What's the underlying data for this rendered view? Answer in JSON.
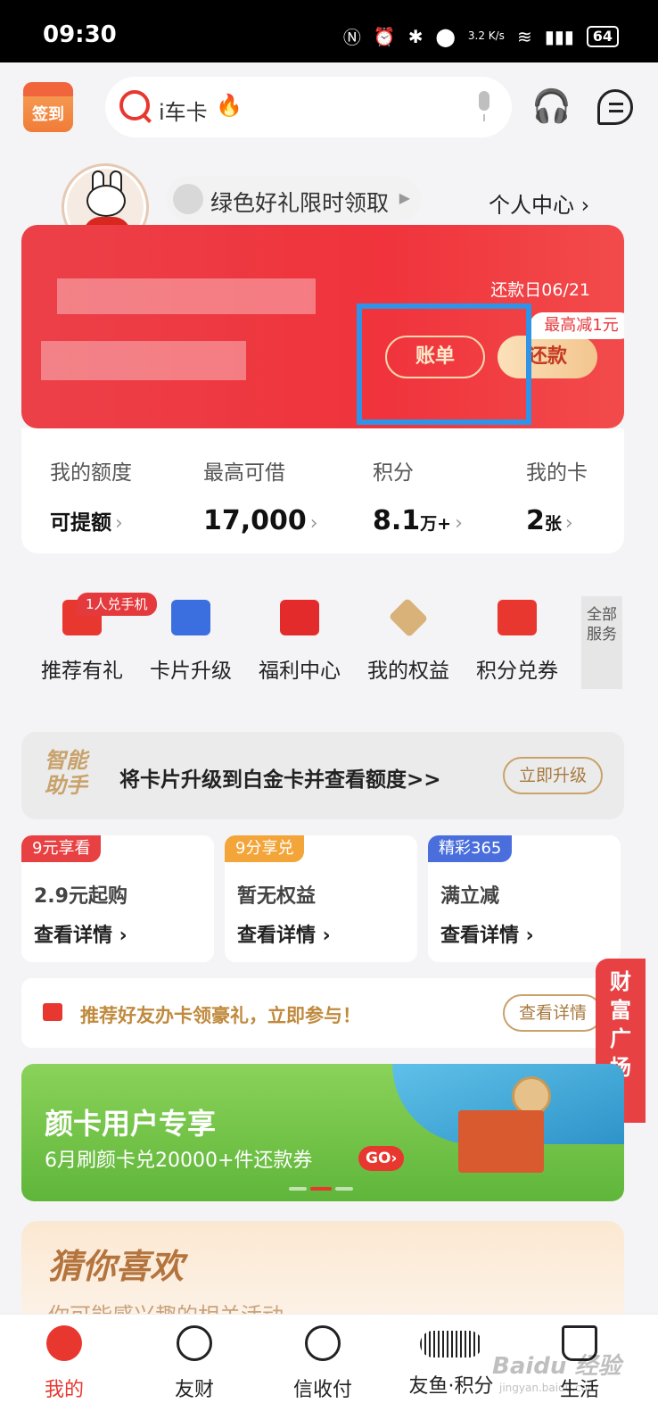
{
  "status_bar": {
    "time": "09:30",
    "speed": "3.2 K/s",
    "battery": "64"
  },
  "header": {
    "checkin_label": "签到",
    "search_text": "i车卡",
    "icons": [
      "search-icon",
      "fire-icon",
      "microphone-icon",
      "headset-icon",
      "message-icon"
    ]
  },
  "profile": {
    "promo_text": "绿色好礼限时领取",
    "personal_center": "个人中心 ›"
  },
  "card": {
    "due_date": "还款日06/21",
    "discount_tag": "最高减1元",
    "bill_label": "账单",
    "repay_label": "还款"
  },
  "stats": [
    {
      "label": "我的额度",
      "value": "可提额",
      "unit": ""
    },
    {
      "label": "最高可借",
      "value": "17,000",
      "unit": ""
    },
    {
      "label": "积分",
      "value": "8.1",
      "unit": "万+"
    },
    {
      "label": "我的卡",
      "value": "2",
      "unit": "张"
    }
  ],
  "services": {
    "items": [
      {
        "label": "推荐有礼",
        "icon": "gift-icon",
        "badge": "1人兑手机"
      },
      {
        "label": "卡片升级",
        "icon": "card-upgrade-icon"
      },
      {
        "label": "福利中心",
        "icon": "red-envelope-icon"
      },
      {
        "label": "我的权益",
        "icon": "diamond-icon"
      },
      {
        "label": "积分兑券",
        "icon": "coupon-icon"
      }
    ],
    "all_label": "全部服务"
  },
  "assistant": {
    "logo": "智能助手",
    "text": "将卡片升级到白金卡并查看额度>>",
    "button": "立即升级"
  },
  "deals": [
    {
      "tag": "9元享看",
      "title": "2.9元起购",
      "link": "查看详情 ›",
      "color": "#e84143"
    },
    {
      "tag": "9分享兑",
      "title": "暂无权益",
      "link": "查看详情 ›",
      "color": "#f3a53a"
    },
    {
      "tag": "精彩365",
      "title": "满立减",
      "link": "查看详情 ›",
      "color": "#4a6fdd"
    }
  ],
  "referral": {
    "text": "推荐好友办卡领豪礼，立即参与！",
    "button": "查看详情"
  },
  "wealth_tab": "财富广场‹",
  "banner": {
    "title": "颜卡用户专享",
    "subtitle": "6月刷颜卡兑20000+件还款券",
    "go": "GO›"
  },
  "guess": {
    "title": "猜你喜欢",
    "subtitle": "你可能感兴趣的相关活动"
  },
  "tabbar": [
    {
      "label": "我的",
      "icon": "user-icon",
      "active": true
    },
    {
      "label": "友财",
      "icon": "wealth-icon"
    },
    {
      "label": "信收付",
      "icon": "instant-discount-icon"
    },
    {
      "label": "友鱼·积分",
      "icon": "fish-icon"
    },
    {
      "label": "生活",
      "icon": "coffee-icon"
    }
  ],
  "watermark": {
    "text": "Baidu 经验",
    "sub": "jingyan.baidu.com"
  },
  "colors": {
    "brand_red": "#e8372f",
    "gold": "#c9a26b",
    "highlight": "#2f93e8"
  }
}
